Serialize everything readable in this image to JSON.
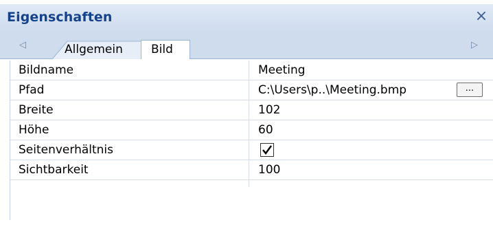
{
  "panel": {
    "title": "Eigenschaften",
    "close_icon": "close-icon"
  },
  "tabs": {
    "nav_left_icon": "chevron-left-icon",
    "nav_right_icon": "chevron-right-icon",
    "items": [
      {
        "label": "Allgemein",
        "selected": false
      },
      {
        "label": "Bild",
        "selected": true
      }
    ]
  },
  "properties": [
    {
      "name": "Bildname",
      "value": "Meeting"
    },
    {
      "name": "Pfad",
      "value": "C:\\Users\\p..\\Meeting.bmp",
      "button_label": "..."
    },
    {
      "name": "Breite",
      "value": "102"
    },
    {
      "name": "Höhe",
      "value": "60"
    },
    {
      "name": "Seitenverhältnis",
      "checked": true
    },
    {
      "name": "Sichtbarkeit",
      "value": "100"
    }
  ]
}
